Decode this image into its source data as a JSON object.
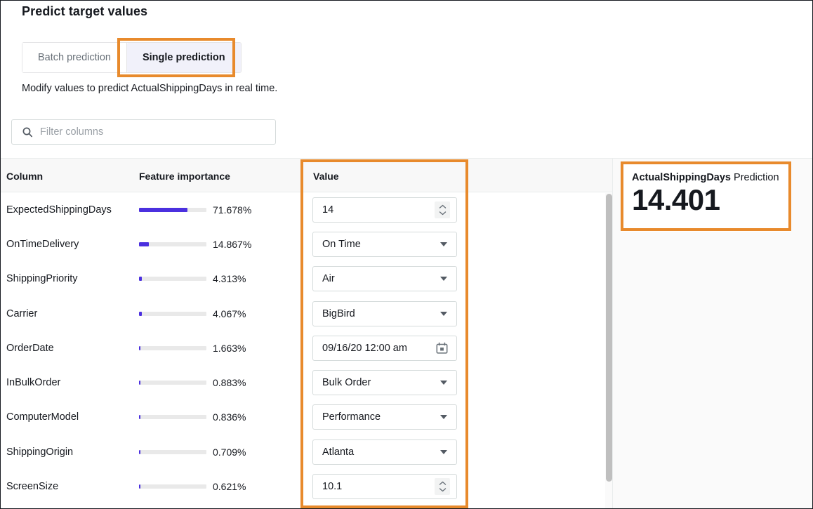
{
  "page": {
    "title": "Predict target values",
    "subtitle": "Modify values to predict ActualShippingDays in real time."
  },
  "tabs": {
    "batch_label": "Batch prediction",
    "single_label": "Single prediction",
    "selected": "Single prediction"
  },
  "filter": {
    "placeholder": "Filter columns",
    "value": "",
    "icon": "search-icon"
  },
  "table": {
    "headers": {
      "column": "Column",
      "importance": "Feature importance",
      "value": "Value"
    },
    "rows": [
      {
        "column": "ExpectedShippingDays",
        "importance_pct": "71.678%",
        "importance": 71.678,
        "control": "number",
        "value": "14",
        "icon": "stepper-icon"
      },
      {
        "column": "OnTimeDelivery",
        "importance_pct": "14.867%",
        "importance": 14.867,
        "control": "select",
        "value": "On Time",
        "icon": "chevron-down-icon"
      },
      {
        "column": "ShippingPriority",
        "importance_pct": "4.313%",
        "importance": 4.313,
        "control": "select",
        "value": "Air",
        "icon": "chevron-down-icon"
      },
      {
        "column": "Carrier",
        "importance_pct": "4.067%",
        "importance": 4.067,
        "control": "select",
        "value": "BigBird",
        "icon": "chevron-down-icon"
      },
      {
        "column": "OrderDate",
        "importance_pct": "1.663%",
        "importance": 1.663,
        "control": "date",
        "value": "09/16/20 12:00 am",
        "icon": "calendar-icon"
      },
      {
        "column": "InBulkOrder",
        "importance_pct": "0.883%",
        "importance": 0.883,
        "control": "select",
        "value": "Bulk Order",
        "icon": "chevron-down-icon"
      },
      {
        "column": "ComputerModel",
        "importance_pct": "0.836%",
        "importance": 0.836,
        "control": "select",
        "value": "Performance",
        "icon": "chevron-down-icon"
      },
      {
        "column": "ShippingOrigin",
        "importance_pct": "0.709%",
        "importance": 0.709,
        "control": "select",
        "value": "Atlanta",
        "icon": "chevron-down-icon"
      },
      {
        "column": "ScreenSize",
        "importance_pct": "0.621%",
        "importance": 0.621,
        "control": "number",
        "value": "10.1",
        "icon": "stepper-icon"
      }
    ]
  },
  "prediction": {
    "target": "ActualShippingDays",
    "label_suffix": " Prediction",
    "value": "14.401"
  },
  "colors": {
    "accent_bar": "#4b30df",
    "bar_track": "#e9e9e9",
    "annotation": "#e88a2c",
    "tab_active_bg": "#f1f1fa"
  }
}
